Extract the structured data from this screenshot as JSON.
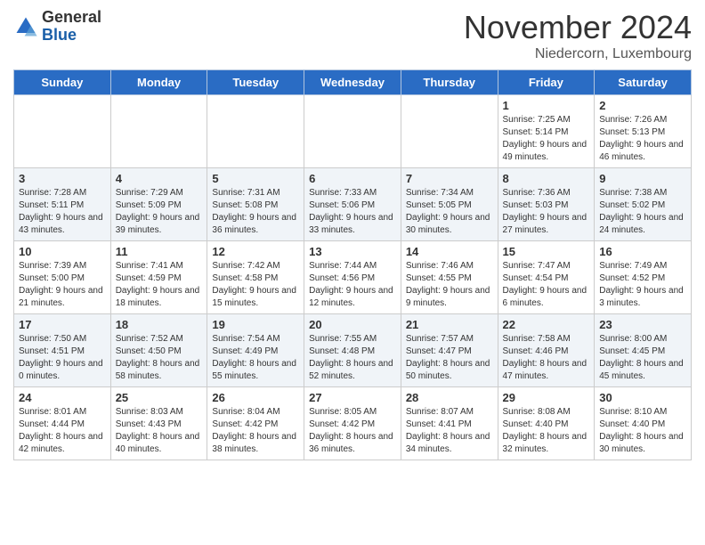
{
  "header": {
    "logo_general": "General",
    "logo_blue": "Blue",
    "month_title": "November 2024",
    "location": "Niedercorn, Luxembourg"
  },
  "weekdays": [
    "Sunday",
    "Monday",
    "Tuesday",
    "Wednesday",
    "Thursday",
    "Friday",
    "Saturday"
  ],
  "weeks": [
    [
      {
        "day": "",
        "info": ""
      },
      {
        "day": "",
        "info": ""
      },
      {
        "day": "",
        "info": ""
      },
      {
        "day": "",
        "info": ""
      },
      {
        "day": "",
        "info": ""
      },
      {
        "day": "1",
        "info": "Sunrise: 7:25 AM\nSunset: 5:14 PM\nDaylight: 9 hours and 49 minutes."
      },
      {
        "day": "2",
        "info": "Sunrise: 7:26 AM\nSunset: 5:13 PM\nDaylight: 9 hours and 46 minutes."
      }
    ],
    [
      {
        "day": "3",
        "info": "Sunrise: 7:28 AM\nSunset: 5:11 PM\nDaylight: 9 hours and 43 minutes."
      },
      {
        "day": "4",
        "info": "Sunrise: 7:29 AM\nSunset: 5:09 PM\nDaylight: 9 hours and 39 minutes."
      },
      {
        "day": "5",
        "info": "Sunrise: 7:31 AM\nSunset: 5:08 PM\nDaylight: 9 hours and 36 minutes."
      },
      {
        "day": "6",
        "info": "Sunrise: 7:33 AM\nSunset: 5:06 PM\nDaylight: 9 hours and 33 minutes."
      },
      {
        "day": "7",
        "info": "Sunrise: 7:34 AM\nSunset: 5:05 PM\nDaylight: 9 hours and 30 minutes."
      },
      {
        "day": "8",
        "info": "Sunrise: 7:36 AM\nSunset: 5:03 PM\nDaylight: 9 hours and 27 minutes."
      },
      {
        "day": "9",
        "info": "Sunrise: 7:38 AM\nSunset: 5:02 PM\nDaylight: 9 hours and 24 minutes."
      }
    ],
    [
      {
        "day": "10",
        "info": "Sunrise: 7:39 AM\nSunset: 5:00 PM\nDaylight: 9 hours and 21 minutes."
      },
      {
        "day": "11",
        "info": "Sunrise: 7:41 AM\nSunset: 4:59 PM\nDaylight: 9 hours and 18 minutes."
      },
      {
        "day": "12",
        "info": "Sunrise: 7:42 AM\nSunset: 4:58 PM\nDaylight: 9 hours and 15 minutes."
      },
      {
        "day": "13",
        "info": "Sunrise: 7:44 AM\nSunset: 4:56 PM\nDaylight: 9 hours and 12 minutes."
      },
      {
        "day": "14",
        "info": "Sunrise: 7:46 AM\nSunset: 4:55 PM\nDaylight: 9 hours and 9 minutes."
      },
      {
        "day": "15",
        "info": "Sunrise: 7:47 AM\nSunset: 4:54 PM\nDaylight: 9 hours and 6 minutes."
      },
      {
        "day": "16",
        "info": "Sunrise: 7:49 AM\nSunset: 4:52 PM\nDaylight: 9 hours and 3 minutes."
      }
    ],
    [
      {
        "day": "17",
        "info": "Sunrise: 7:50 AM\nSunset: 4:51 PM\nDaylight: 9 hours and 0 minutes."
      },
      {
        "day": "18",
        "info": "Sunrise: 7:52 AM\nSunset: 4:50 PM\nDaylight: 8 hours and 58 minutes."
      },
      {
        "day": "19",
        "info": "Sunrise: 7:54 AM\nSunset: 4:49 PM\nDaylight: 8 hours and 55 minutes."
      },
      {
        "day": "20",
        "info": "Sunrise: 7:55 AM\nSunset: 4:48 PM\nDaylight: 8 hours and 52 minutes."
      },
      {
        "day": "21",
        "info": "Sunrise: 7:57 AM\nSunset: 4:47 PM\nDaylight: 8 hours and 50 minutes."
      },
      {
        "day": "22",
        "info": "Sunrise: 7:58 AM\nSunset: 4:46 PM\nDaylight: 8 hours and 47 minutes."
      },
      {
        "day": "23",
        "info": "Sunrise: 8:00 AM\nSunset: 4:45 PM\nDaylight: 8 hours and 45 minutes."
      }
    ],
    [
      {
        "day": "24",
        "info": "Sunrise: 8:01 AM\nSunset: 4:44 PM\nDaylight: 8 hours and 42 minutes."
      },
      {
        "day": "25",
        "info": "Sunrise: 8:03 AM\nSunset: 4:43 PM\nDaylight: 8 hours and 40 minutes."
      },
      {
        "day": "26",
        "info": "Sunrise: 8:04 AM\nSunset: 4:42 PM\nDaylight: 8 hours and 38 minutes."
      },
      {
        "day": "27",
        "info": "Sunrise: 8:05 AM\nSunset: 4:42 PM\nDaylight: 8 hours and 36 minutes."
      },
      {
        "day": "28",
        "info": "Sunrise: 8:07 AM\nSunset: 4:41 PM\nDaylight: 8 hours and 34 minutes."
      },
      {
        "day": "29",
        "info": "Sunrise: 8:08 AM\nSunset: 4:40 PM\nDaylight: 8 hours and 32 minutes."
      },
      {
        "day": "30",
        "info": "Sunrise: 8:10 AM\nSunset: 4:40 PM\nDaylight: 8 hours and 30 minutes."
      }
    ]
  ]
}
